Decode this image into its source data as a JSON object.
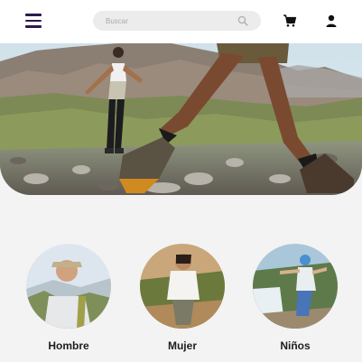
{
  "header": {
    "menu_icon": "hamburger-menu-icon",
    "search": {
      "placeholder": "Buscar",
      "value": "",
      "icon": "search-icon"
    },
    "cart_icon": "cart-icon",
    "user_icon": "user-icon"
  },
  "hero": {
    "image": "hikers-on-rocky-mountain-trail"
  },
  "categories": [
    {
      "label": "Hombre"
    },
    {
      "label": "Mujer"
    },
    {
      "label": "Niños"
    }
  ],
  "colors": {
    "accent": "#2d1a4a",
    "background": "#f3f3f3",
    "boot": "#d08a1f"
  }
}
